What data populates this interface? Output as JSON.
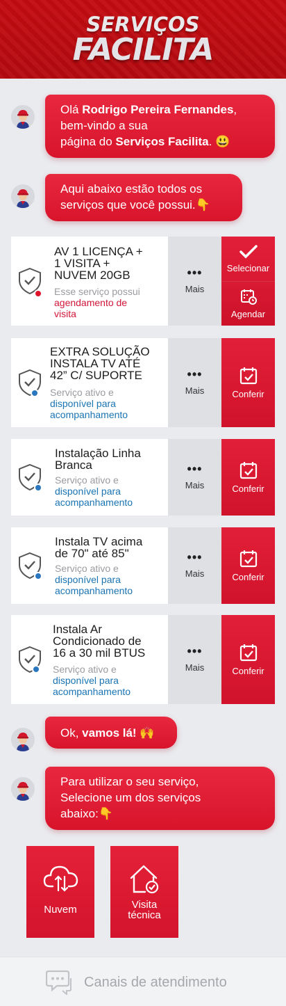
{
  "header": {
    "brand_top": "SERVIÇOS",
    "brand_bottom": "FACILITA",
    "accent_color": "#c40c12"
  },
  "chat": {
    "greeting": {
      "prefix": "Olá ",
      "name": "Rodrigo Pereira Fernandes",
      "line2": "bem-vindo a sua",
      "line3_prefix": "página do ",
      "brand": "Serviços Facilita",
      "emoji": ". 😃"
    },
    "intro": {
      "line1": "Aqui abaixo estão todos os",
      "line2": "serviços que você possui.👇"
    },
    "ok": {
      "prefix": "Ok, ",
      "bold": "vamos lá!",
      "emoji": " 🙌"
    },
    "select": {
      "line1": "Para utilizar o seu serviço,",
      "line2": "Selecione um dos serviços",
      "line3": "abaixo:👇"
    }
  },
  "services": [
    {
      "title_lines": [
        "AV 1 LICENÇA +",
        "1 VISITA +",
        "NUVEM 20GB"
      ],
      "desc_plain": "Esse serviço possui",
      "desc_hl": [
        "agendamento de",
        "visita"
      ],
      "status": "scheduling",
      "more_label": "Mais",
      "actions": [
        "Selecionar",
        "Agendar"
      ]
    },
    {
      "title_lines": [
        "EXTRA SOLUÇÃO",
        "INSTALA TV ATÉ",
        "42” C/ SUPORTE"
      ],
      "desc_plain": "Serviço ativo e",
      "desc_hl": [
        "disponível para",
        "acompanhamento"
      ],
      "status": "active",
      "more_label": "Mais",
      "actions": [
        "Conferir"
      ]
    },
    {
      "title_lines": [
        "Instalação Linha",
        "Branca"
      ],
      "desc_plain": "Serviço ativo e",
      "desc_hl": [
        "disponível para",
        "acompanhamento"
      ],
      "status": "active",
      "more_label": "Mais",
      "actions": [
        "Conferir"
      ]
    },
    {
      "title_lines": [
        "Instala TV acima",
        "de 70\" até 85\""
      ],
      "desc_plain": "Serviço ativo e",
      "desc_hl": [
        "disponível para",
        "acompanhamento"
      ],
      "status": "active",
      "more_label": "Mais",
      "actions": [
        "Conferir"
      ]
    },
    {
      "title_lines": [
        "Instala Ar",
        "Condicionado de",
        "16 a 30 mil BTUS"
      ],
      "desc_plain": "Serviço ativo e",
      "desc_hl": [
        "disponível para",
        "acompanhamento"
      ],
      "status": "active",
      "more_label": "Mais",
      "actions": [
        "Conferir"
      ]
    }
  ],
  "options": [
    {
      "label_lines": [
        "Nuvem"
      ],
      "icon": "cloud-icon"
    },
    {
      "label_lines": [
        "Visita",
        "técnica"
      ],
      "icon": "house-check-icon"
    }
  ],
  "footer": {
    "label": "Canais de atendimento",
    "icon": "chat-bubbles-icon"
  },
  "colors": {
    "scheduling_dot": "#e0122a",
    "active_dot": "#2a77c0"
  }
}
